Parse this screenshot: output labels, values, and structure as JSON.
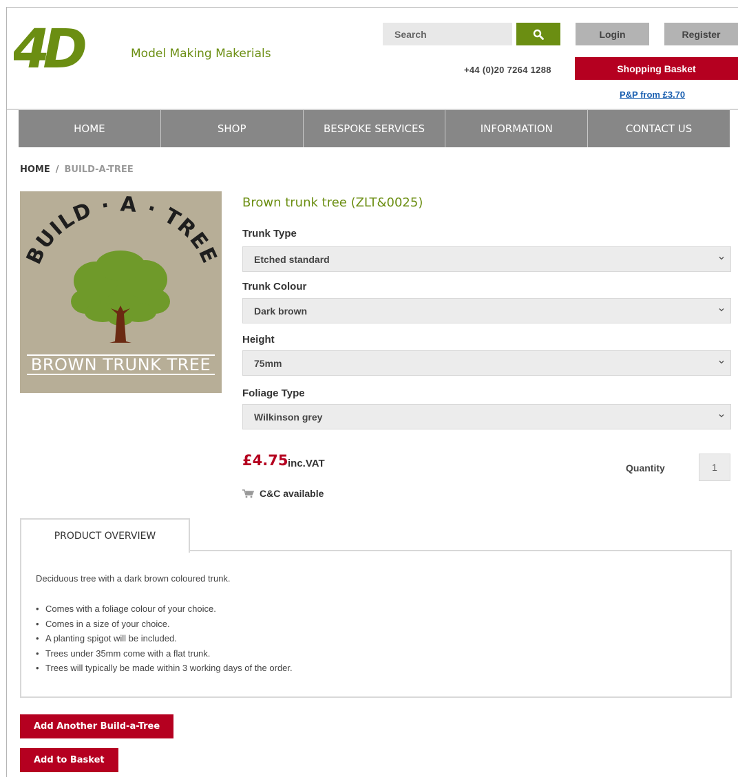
{
  "header": {
    "logo_text": "4D",
    "tagline": "Model Making Makerials",
    "search_placeholder": "Search",
    "login_label": "Login",
    "register_label": "Register",
    "phone": "+44 (0)20 7264 1288",
    "basket_label": "Shopping Basket",
    "pp_link": "P&P from £3.70",
    "brand_green": "#6b8e12",
    "brand_red": "#b50020"
  },
  "nav": {
    "items": [
      {
        "label": "HOME"
      },
      {
        "label": "SHOP"
      },
      {
        "label": "BESPOKE SERVICES"
      },
      {
        "label": "INFORMATION"
      },
      {
        "label": "CONTACT US"
      }
    ]
  },
  "breadcrumb": {
    "home": "HOME",
    "separator": "/",
    "current": "BUILD-A-TREE"
  },
  "image": {
    "arc_text": "BUILD · A · TREE",
    "label": "BROWN TRUNK TREE"
  },
  "product": {
    "title": "Brown trunk tree (ZLT&0025)",
    "options": [
      {
        "label": "Trunk Type",
        "value": "Etched standard"
      },
      {
        "label": "Trunk Colour",
        "value": "Dark brown"
      },
      {
        "label": "Height",
        "value": "75mm"
      },
      {
        "label": "Foliage Type",
        "value": "Wilkinson grey"
      }
    ],
    "price": "£4.75",
    "price_suffix": "inc.VAT",
    "quantity_label": "Quantity",
    "quantity_value": "1",
    "cc_text": "C&C available"
  },
  "overview": {
    "tab_label": "PRODUCT OVERVIEW",
    "description": "Deciduous tree with a dark brown coloured trunk.",
    "bullets": [
      "Comes with a foliage colour of your choice.",
      "Comes in a size of your choice.",
      "A planting spigot will be included.",
      "Trees under 35mm come with a flat trunk.",
      "Trees will typically be made within 3 working days of the order."
    ]
  },
  "actions": {
    "add_another": "Add Another Build-a-Tree",
    "add_to_basket": "Add to Basket"
  }
}
